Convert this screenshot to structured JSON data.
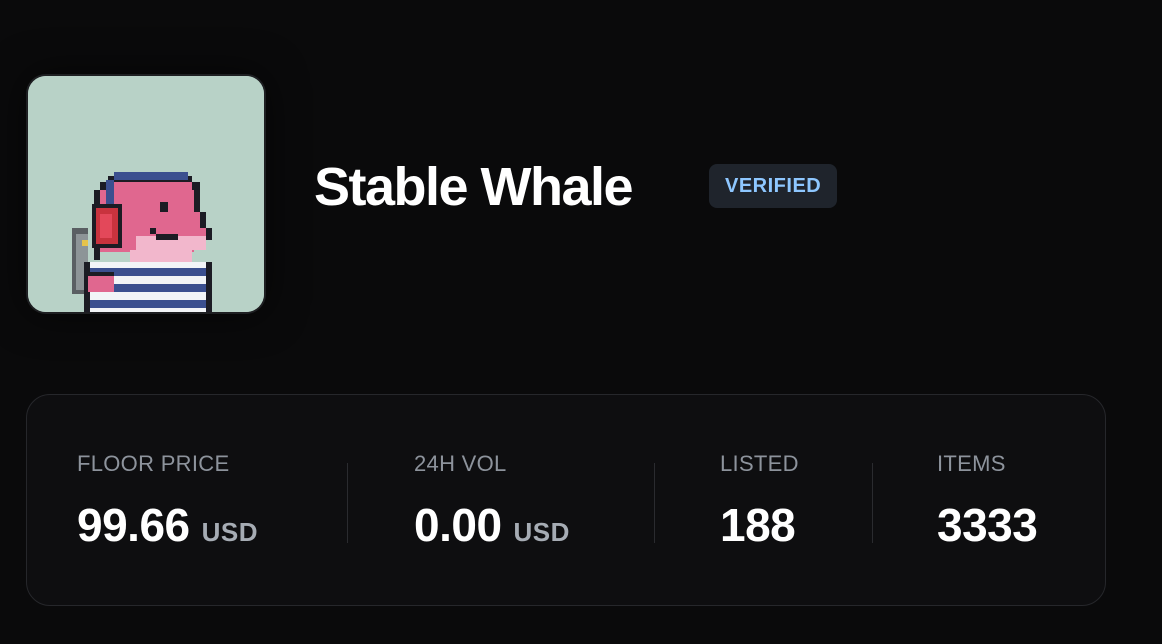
{
  "collection": {
    "name": "Stable Whale",
    "badge": "VERIFIED",
    "avatar": {
      "icon": "pixel-whale-icon",
      "background_color": "#b8d2c7",
      "body_color": "#e0678f",
      "stripe_color": "#3b4f8f"
    }
  },
  "stats": [
    {
      "label": "FLOOR PRICE",
      "value": "99.66",
      "unit": "USD"
    },
    {
      "label": "24H VOL",
      "value": "0.00",
      "unit": "USD"
    },
    {
      "label": "LISTED",
      "value": "188",
      "unit": ""
    },
    {
      "label": "ITEMS",
      "value": "3333",
      "unit": ""
    }
  ],
  "colors": {
    "background": "#0a0a0b",
    "badge_text": "#8ec7ff",
    "label_text": "#8d939c"
  }
}
